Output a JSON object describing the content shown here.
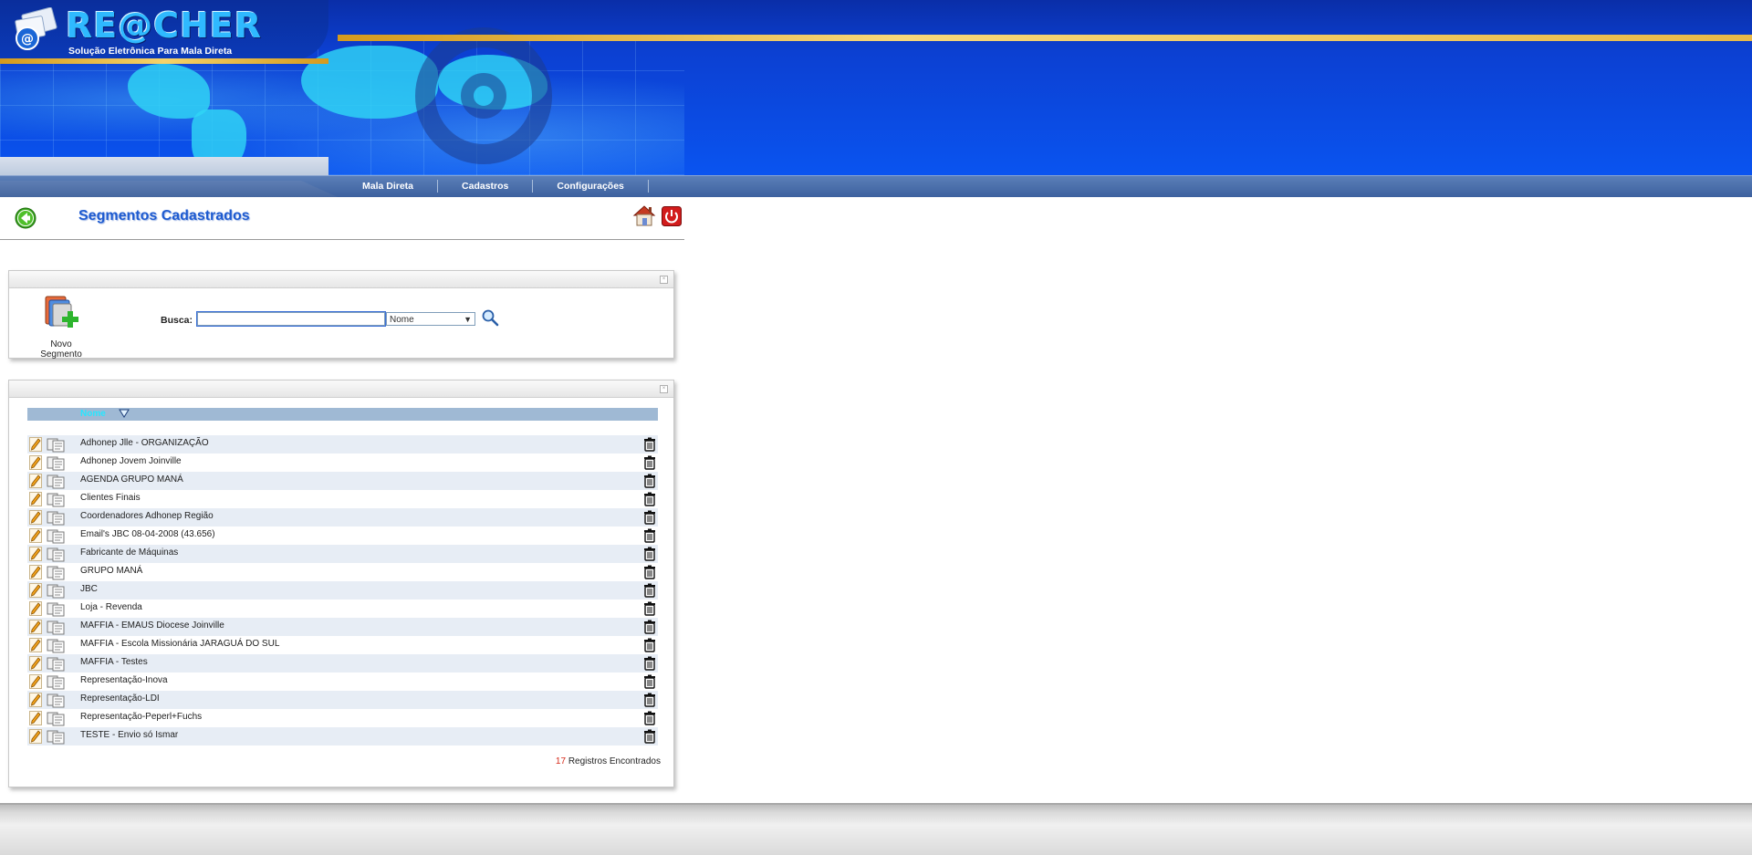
{
  "app": {
    "logo_title": "RE@CHER",
    "logo_subtitle": "Solução Eletrônica Para Mala Direta"
  },
  "nav": {
    "items": [
      {
        "label": "Mala Direta"
      },
      {
        "label": "Cadastros"
      },
      {
        "label": "Configurações"
      }
    ]
  },
  "page": {
    "title": "Segmentos Cadastrados"
  },
  "toolbar": {
    "new_segment_label": "Novo Segmento",
    "search_label": "Busca:",
    "search_value": "",
    "search_field_selected": "Nome"
  },
  "list": {
    "column_name": "Nome",
    "rows": [
      {
        "name": "Adhonep Jlle - ORGANIZAÇÃO"
      },
      {
        "name": "Adhonep Jovem Joinville"
      },
      {
        "name": "AGENDA GRUPO MANÁ"
      },
      {
        "name": "Clientes Finais"
      },
      {
        "name": "Coordenadores Adhonep Região"
      },
      {
        "name": "Email's JBC 08-04-2008 (43.656)"
      },
      {
        "name": "Fabricante de Máquinas"
      },
      {
        "name": "GRUPO MANÁ"
      },
      {
        "name": "JBC"
      },
      {
        "name": "Loja - Revenda"
      },
      {
        "name": "MAFFIA - EMAUS Diocese Joinville"
      },
      {
        "name": "MAFFIA - Escola Missionária JARAGUÁ DO SUL"
      },
      {
        "name": "MAFFIA - Testes"
      },
      {
        "name": "Representação-Inova"
      },
      {
        "name": "Representação-LDI"
      },
      {
        "name": "Representação-Peperl+Fuchs"
      },
      {
        "name": "TESTE - Envio só Ismar"
      }
    ],
    "records_count": "17",
    "records_label": "Registros Encontrados"
  },
  "colors": {
    "header_blue": "#0a54f0",
    "title_blue": "#1e5bd0",
    "row_alt": "#e7edf5",
    "count_red": "#d62a1a"
  }
}
